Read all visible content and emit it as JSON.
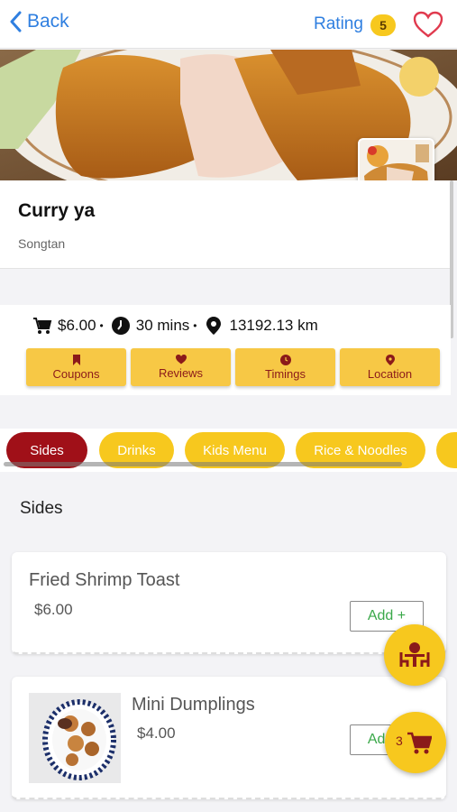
{
  "header": {
    "back_label": "Back",
    "rating_label": "Rating",
    "rating_value": "5"
  },
  "restaurant": {
    "name": "Curry ya",
    "location": "Songtan"
  },
  "stats": {
    "price": "$6.00",
    "time": "30 mins",
    "distance": "13192.13 km",
    "separator": "•"
  },
  "actions": [
    {
      "label": "Coupons",
      "icon": "bookmark-icon"
    },
    {
      "label": "Reviews",
      "icon": "heart-icon"
    },
    {
      "label": "Timings",
      "icon": "clock-icon"
    },
    {
      "label": "Location",
      "icon": "location-pin-icon"
    }
  ],
  "categories": [
    {
      "label": "Sides",
      "active": true
    },
    {
      "label": "Drinks",
      "active": false
    },
    {
      "label": "Kids Menu",
      "active": false
    },
    {
      "label": "Rice & Noodles",
      "active": false
    },
    {
      "label": "",
      "active": false
    }
  ],
  "section_title": "Sides",
  "items": [
    {
      "name": "Fried Shrimp Toast",
      "price": "$6.00",
      "add_label": "Add  +"
    },
    {
      "name": "Mini Dumplings",
      "price": "$4.00",
      "add_label": "Add  +"
    }
  ],
  "cart": {
    "count": "3"
  },
  "colors": {
    "accent_blue": "#2f7fe0",
    "chip_yellow": "#f7c81e",
    "chip_active": "#a01018",
    "button_yellow": "#f7c845",
    "add_green": "#3aa84a"
  }
}
